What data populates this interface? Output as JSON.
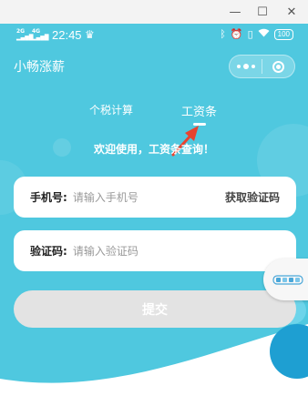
{
  "window": {
    "min_glyph": "—",
    "max_glyph": "☐",
    "close_glyph": "✕"
  },
  "status_bar": {
    "signal_1": "2G",
    "signal_2": "4G",
    "time": "22:45",
    "battery": "100",
    "icons": [
      "bluetooth-icon",
      "alarm-icon",
      "vibrate-icon",
      "wifi-icon",
      "battery-icon"
    ]
  },
  "nav": {
    "title": "小畅涨薪",
    "capsule_icons": [
      "more-icon",
      "close-target-icon"
    ]
  },
  "tabs": [
    {
      "label": "个税计算",
      "active": false
    },
    {
      "label": "工资条",
      "active": true
    }
  ],
  "welcome_text": "欢迎使用，工资条查询！",
  "form": {
    "phone": {
      "label": "手机号:",
      "placeholder": "请输入手机号",
      "value": "",
      "action_label": "获取验证码"
    },
    "code": {
      "label": "验证码:",
      "placeholder": "请输入验证码",
      "value": ""
    },
    "submit_label": "提交"
  },
  "colors": {
    "primary": "#4fc8df",
    "wave": "#ffffff",
    "submit_bg": "#e3e3e3",
    "arrow": "#e8432f"
  }
}
